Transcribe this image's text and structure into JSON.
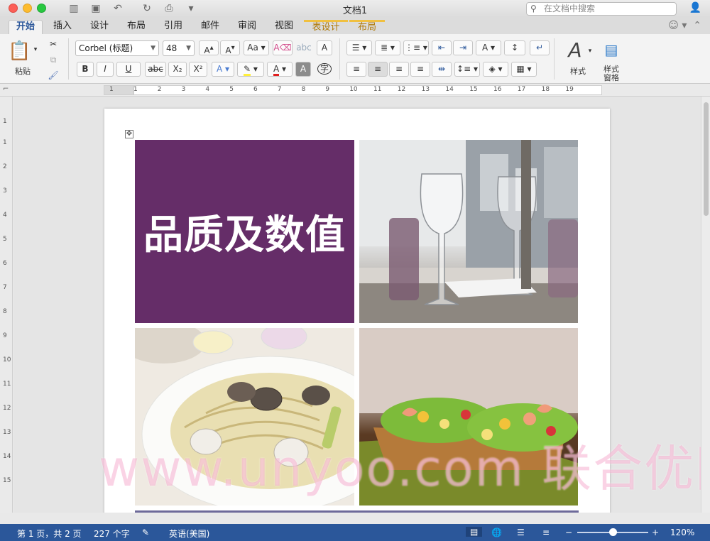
{
  "window": {
    "title": "文档1"
  },
  "search": {
    "placeholder": "在文档中搜索"
  },
  "tabs": [
    {
      "label": "开始"
    },
    {
      "label": "插入"
    },
    {
      "label": "设计"
    },
    {
      "label": "布局"
    },
    {
      "label": "引用"
    },
    {
      "label": "邮件"
    },
    {
      "label": "审阅"
    },
    {
      "label": "视图"
    },
    {
      "label": "表设计"
    },
    {
      "label": "布局"
    }
  ],
  "ribbon": {
    "paste_label": "粘贴",
    "font_name": "Corbel (标题)",
    "font_size": "48",
    "styles_label": "样式",
    "styles_pane_label": "样式\n窗格",
    "bold": "B",
    "italic": "I",
    "underline": "U",
    "strike": "abc",
    "subscript": "X₂",
    "superscript": "X²",
    "char_label": "字"
  },
  "ruler": {
    "numbers": [
      "1",
      "1",
      "2",
      "3",
      "4",
      "5",
      "6",
      "7",
      "8",
      "9",
      "10",
      "11",
      "12",
      "13",
      "14",
      "15",
      "16",
      "17",
      "18",
      "19"
    ]
  },
  "vruler": {
    "numbers": [
      "1",
      "1",
      "2",
      "3",
      "4",
      "5",
      "6",
      "7",
      "8",
      "9",
      "10",
      "11",
      "12",
      "13",
      "14",
      "15"
    ]
  },
  "document": {
    "headline": "品质及数值",
    "watermark": "www.unyoo.com 联合优网"
  },
  "colors": {
    "brand": "#2b579a",
    "purple": "#652d68",
    "context_tab": "#b07a0a"
  },
  "status": {
    "page": "第 1 页，共 2 页",
    "words": "227 个字",
    "language": "英语(美国)",
    "zoom": "120%",
    "zoom_level": 0.5
  }
}
